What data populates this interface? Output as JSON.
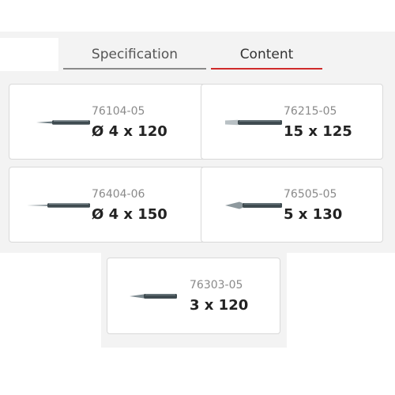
{
  "tabs": {
    "specification": "Specification",
    "content": "Content",
    "active": "content"
  },
  "products": [
    {
      "code": "76104-05",
      "size": "Ø 4 x 120",
      "tool_icon": "pin-punch-icon"
    },
    {
      "code": "76215-05",
      "size": "15 x 125",
      "tool_icon": "flat-chisel-icon"
    },
    {
      "code": "76404-06",
      "size": "Ø 4 x 150",
      "tool_icon": "long-pin-punch-icon"
    },
    {
      "code": "76505-05",
      "size": "5 x 130",
      "tool_icon": "cape-chisel-icon"
    },
    {
      "code": "76303-05",
      "size": "3 x 120",
      "tool_icon": "center-punch-icon"
    }
  ],
  "colors": {
    "active_tab_underline": "#cf2a2a",
    "inactive_tab_underline": "#8a8a8a",
    "card_border": "#d9d9d9",
    "background_panel": "#f3f3f3"
  }
}
